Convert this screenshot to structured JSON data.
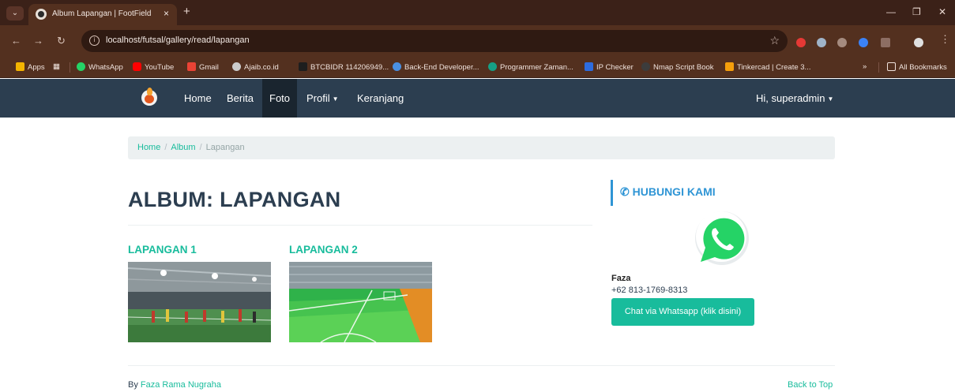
{
  "browser": {
    "tab_title": "Album Lapangan | FootField",
    "tab_close": "×",
    "new_tab": "+",
    "url": "localhost/futsal/gallery/read/lapangan",
    "bookmarks": [
      {
        "label": "Apps",
        "color": "#f4b400"
      },
      {
        "label": "WhatsApp",
        "color": "#25d366"
      },
      {
        "label": "YouTube",
        "color": "#ff0000"
      },
      {
        "label": "Gmail",
        "color": "#ea4335"
      },
      {
        "label": "Ajaib.co.id",
        "color": "#cccccc"
      },
      {
        "label": "BTCBIDR 114206949...",
        "color": "#1e1e1e"
      },
      {
        "label": "Back-End Developer...",
        "color": "#4a90e2"
      },
      {
        "label": "Programmer Zaman...",
        "color": "#16a085"
      },
      {
        "label": "IP Checker",
        "color": "#2d6cdf"
      },
      {
        "label": "Nmap Script Book",
        "color": "#3c3c3c"
      },
      {
        "label": "Tinkercad | Create 3...",
        "color": "#f59e0b"
      }
    ],
    "bookmarks_more": "»",
    "all_bookmarks": "All Bookmarks"
  },
  "site": {
    "nav": {
      "items": [
        {
          "label": "Home"
        },
        {
          "label": "Berita"
        },
        {
          "label": "Foto"
        },
        {
          "label": "Profil"
        },
        {
          "label": "Keranjang"
        }
      ],
      "user_label": "Hi, superadmin"
    },
    "breadcrumb": {
      "home": "Home",
      "album": "Album",
      "current": "Lapangan",
      "separator": "/"
    },
    "page_title": "ALBUM: LAPANGAN",
    "photos": [
      {
        "title": "LAPANGAN 1"
      },
      {
        "title": "LAPANGAN 2"
      }
    ],
    "sidebar": {
      "heading": "HUBUNGI KAMI",
      "contact_name": "Faza",
      "contact_phone": "+62 813-1769-8313",
      "button_label": "Chat via Whatsapp (klik disini)"
    },
    "footer": {
      "by_prefix": "By",
      "author": "Faza Rama Nugraha",
      "back_to_top": "Back to Top"
    }
  },
  "colors": {
    "accent": "#18bc9c",
    "navbar": "#2c3e50",
    "heading_blue": "#2f95d5",
    "whatsapp": "#25d366"
  },
  "icons": {
    "tab_favicon": "soccer-ball-icon",
    "sidebar_heading": "phone-icon",
    "whatsapp": "whatsapp-logo-icon"
  }
}
